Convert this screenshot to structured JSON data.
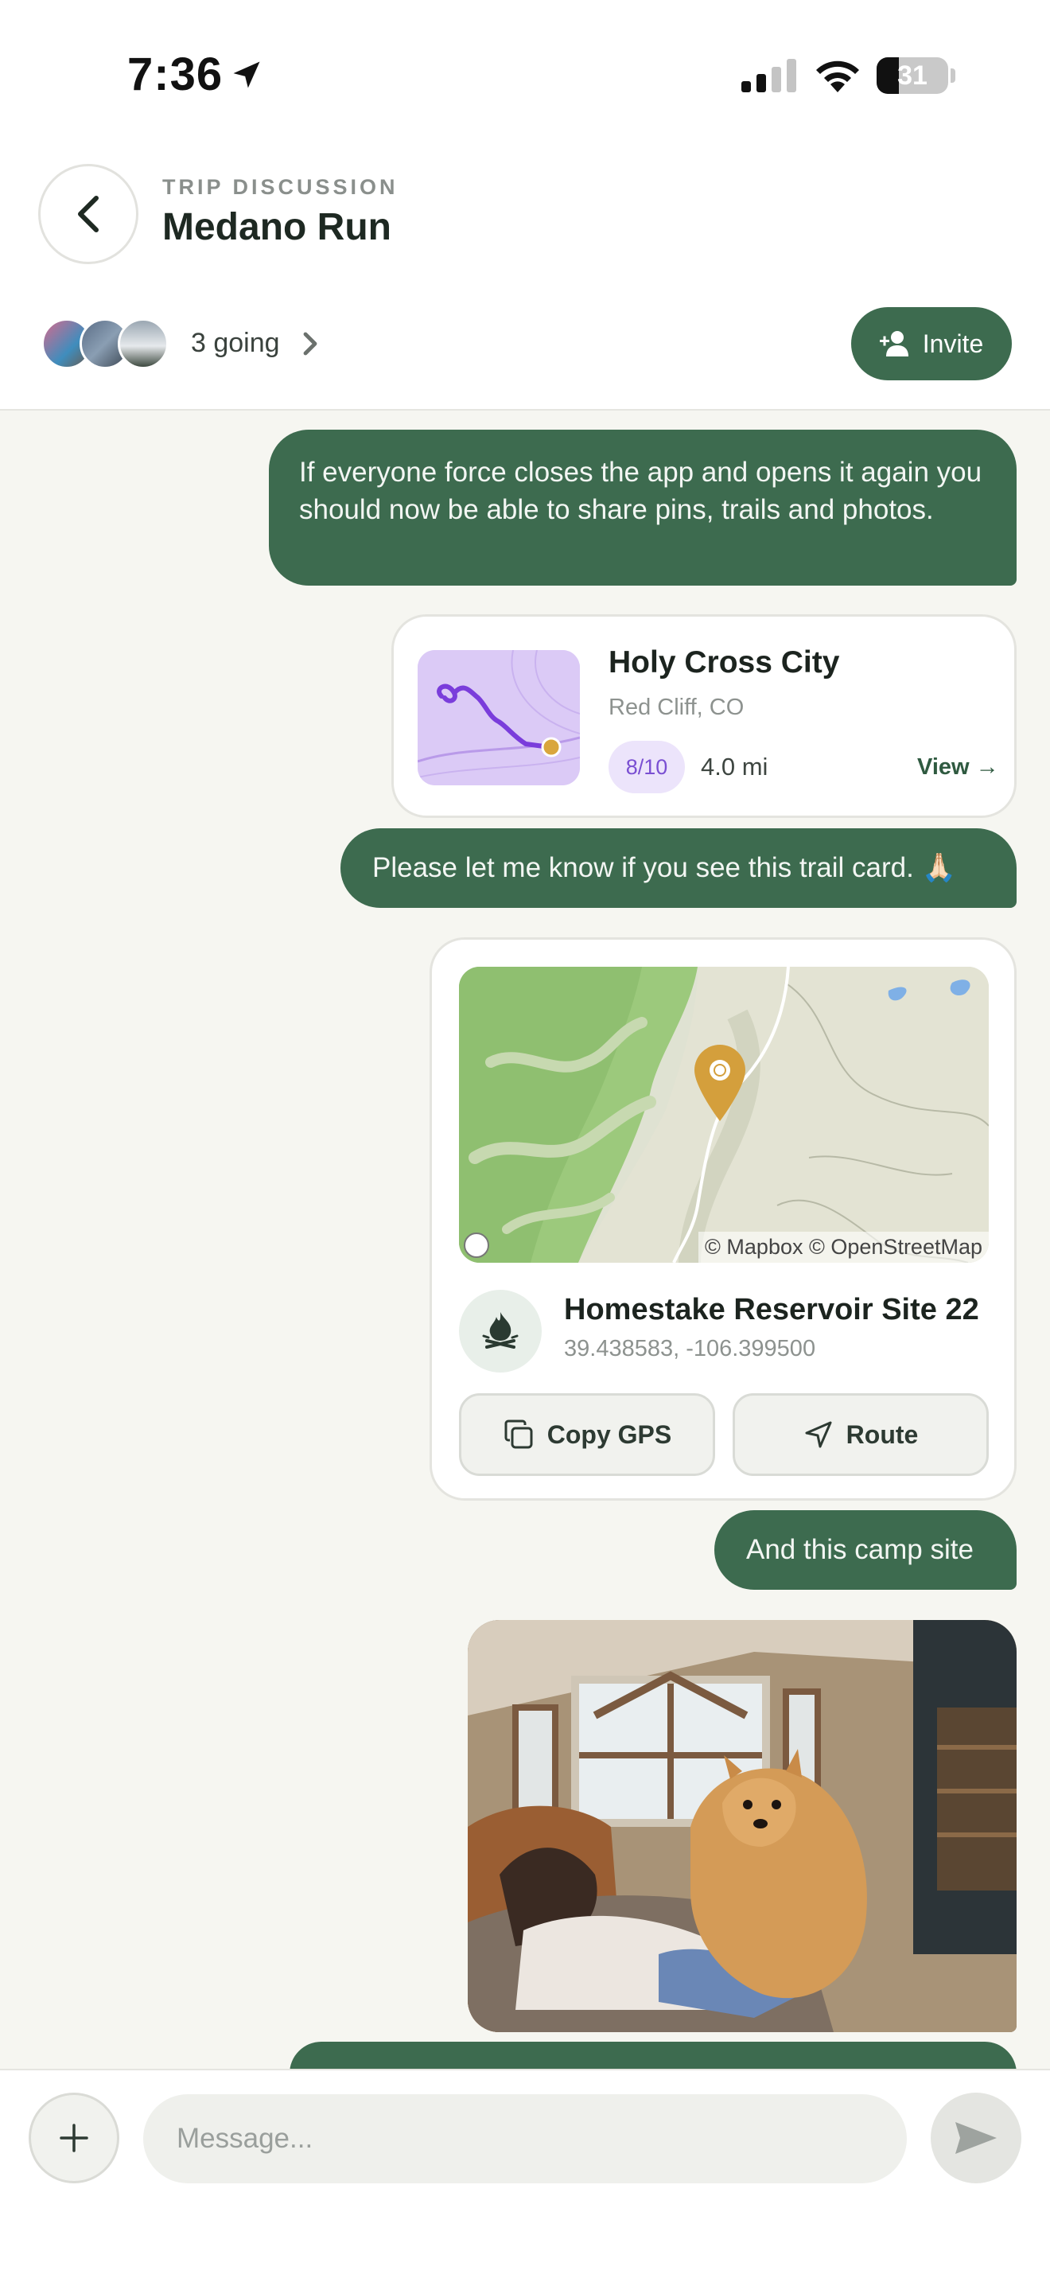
{
  "status_bar": {
    "time": "7:36",
    "battery": "31",
    "battery_level": 0.31,
    "icons": [
      "location-arrow-icon",
      "cellular-signal-icon",
      "wifi-icon",
      "battery-icon"
    ]
  },
  "header": {
    "kicker": "TRIP DISCUSSION",
    "title": "Medano Run",
    "going_label": "3 going",
    "invite_label": "Invite"
  },
  "messages": {
    "msg1": "If everyone force closes the app and opens it again you should now be able to share pins, trails and photos.",
    "msg2": "Please let me know if you see this trail card. 🙏🏻",
    "msg3": "And this camp site"
  },
  "trail_card": {
    "name": "Holy Cross City",
    "location": "Red Cliff, CO",
    "rating": "8/10",
    "distance": "4.0 mi",
    "view_label": "View →"
  },
  "pin_card": {
    "map_attribution": "© Mapbox © OpenStreetMap",
    "name": "Homestake Reservoir Site 22",
    "coords": "39.438583, -106.399500",
    "copy_label": "Copy GPS",
    "route_label": "Route",
    "icon": "campfire-icon"
  },
  "composer": {
    "placeholder": "Message..."
  },
  "colors": {
    "accent": "#3d6b4f",
    "background": "#f6f6f1",
    "trail_purple": "#7a4fd2",
    "pin_gold": "#d49f3c"
  }
}
